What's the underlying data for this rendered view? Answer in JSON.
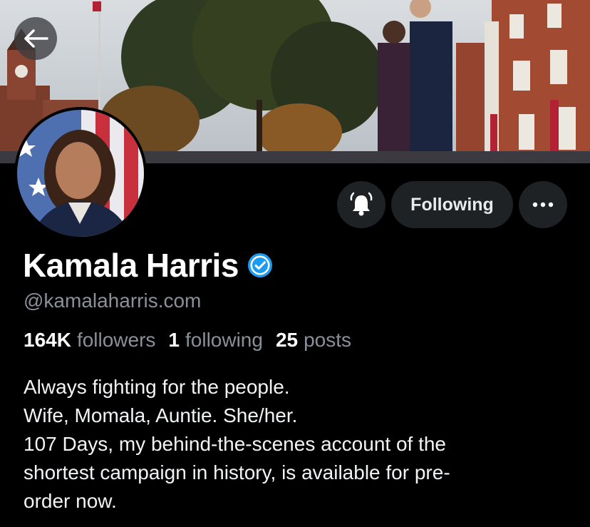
{
  "navigation": {
    "back_icon": "arrow-left-icon"
  },
  "actions": {
    "bell_icon": "bell-ringing-icon",
    "following_label": "Following",
    "more_icon": "ellipsis-icon"
  },
  "profile": {
    "name": "Kamala Harris",
    "verified_icon": "verified-badge-icon",
    "handle": "@kamalaharris.com",
    "stats": {
      "followers_count": "164K",
      "followers_label": "followers",
      "following_count": "1",
      "following_label": "following",
      "posts_count": "25",
      "posts_label": "posts"
    },
    "bio_lines": [
      "Always fighting for the people.",
      "Wife, Momala, Auntie. She/her.",
      "107 Days, my behind-the-scenes account of the",
      "shortest campaign in history, is available for pre-",
      "order now."
    ]
  },
  "colors": {
    "background": "#000000",
    "button_bg": "#1f2225",
    "muted_text": "#8a9099",
    "verified_blue": "#1d9bf0"
  }
}
